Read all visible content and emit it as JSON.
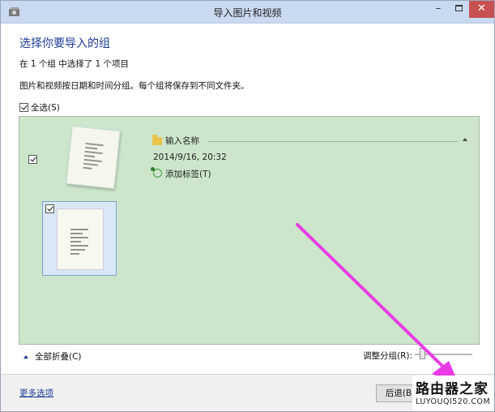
{
  "window": {
    "title": "导入图片和视频",
    "minimize_glyph": "–",
    "close_glyph": "✕"
  },
  "main": {
    "heading": "选择你要导入的组",
    "selection_status": "在 1 个组 中选择了 1 个项目",
    "description": "图片和视频按日期和时间分组。每个组将保存到不同文件夹。",
    "select_all_label": "全选(S)"
  },
  "group": {
    "name_placeholder": "输入名称",
    "date": "2014/9/16, 20:32",
    "add_tag_label": "添加标签(T)"
  },
  "bottom_bar": {
    "collapse_all_label": "全部折叠(C)",
    "adjust_groups_label": "调整分组(R):"
  },
  "footer": {
    "more_options_label": "更多选项",
    "back_button_label": "后退(B)"
  },
  "watermark": {
    "top": "路由器之家",
    "bottom": "LUYOUQI520.COM"
  },
  "colors": {
    "titlebar": "#c9d9ef",
    "close_button": "#c75050",
    "heading": "#1e3c96",
    "group_panel": "#cde6cb",
    "highlight_border": "#e0171d",
    "annotation_arrow": "#e83be6"
  }
}
